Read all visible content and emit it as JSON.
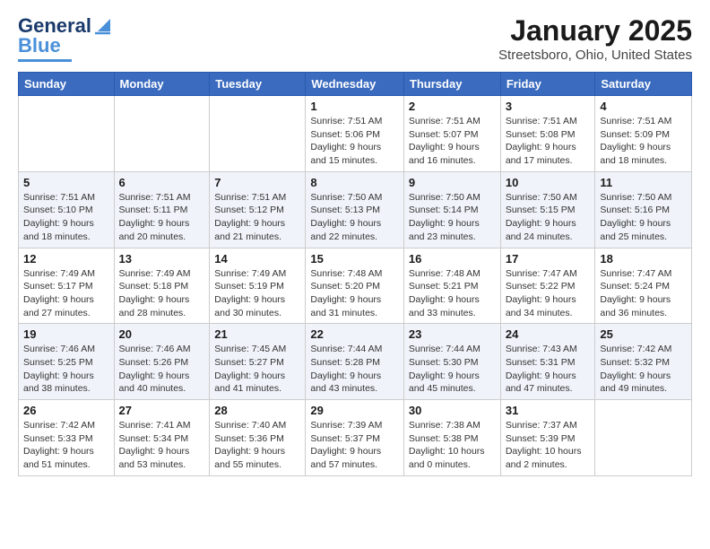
{
  "header": {
    "logo_text1": "General",
    "logo_text2": "Blue",
    "month": "January 2025",
    "location": "Streetsboro, Ohio, United States"
  },
  "weekdays": [
    "Sunday",
    "Monday",
    "Tuesday",
    "Wednesday",
    "Thursday",
    "Friday",
    "Saturday"
  ],
  "weeks": [
    [
      {
        "day": "",
        "info": ""
      },
      {
        "day": "",
        "info": ""
      },
      {
        "day": "",
        "info": ""
      },
      {
        "day": "1",
        "info": "Sunrise: 7:51 AM\nSunset: 5:06 PM\nDaylight: 9 hours\nand 15 minutes."
      },
      {
        "day": "2",
        "info": "Sunrise: 7:51 AM\nSunset: 5:07 PM\nDaylight: 9 hours\nand 16 minutes."
      },
      {
        "day": "3",
        "info": "Sunrise: 7:51 AM\nSunset: 5:08 PM\nDaylight: 9 hours\nand 17 minutes."
      },
      {
        "day": "4",
        "info": "Sunrise: 7:51 AM\nSunset: 5:09 PM\nDaylight: 9 hours\nand 18 minutes."
      }
    ],
    [
      {
        "day": "5",
        "info": "Sunrise: 7:51 AM\nSunset: 5:10 PM\nDaylight: 9 hours\nand 18 minutes."
      },
      {
        "day": "6",
        "info": "Sunrise: 7:51 AM\nSunset: 5:11 PM\nDaylight: 9 hours\nand 20 minutes."
      },
      {
        "day": "7",
        "info": "Sunrise: 7:51 AM\nSunset: 5:12 PM\nDaylight: 9 hours\nand 21 minutes."
      },
      {
        "day": "8",
        "info": "Sunrise: 7:50 AM\nSunset: 5:13 PM\nDaylight: 9 hours\nand 22 minutes."
      },
      {
        "day": "9",
        "info": "Sunrise: 7:50 AM\nSunset: 5:14 PM\nDaylight: 9 hours\nand 23 minutes."
      },
      {
        "day": "10",
        "info": "Sunrise: 7:50 AM\nSunset: 5:15 PM\nDaylight: 9 hours\nand 24 minutes."
      },
      {
        "day": "11",
        "info": "Sunrise: 7:50 AM\nSunset: 5:16 PM\nDaylight: 9 hours\nand 25 minutes."
      }
    ],
    [
      {
        "day": "12",
        "info": "Sunrise: 7:49 AM\nSunset: 5:17 PM\nDaylight: 9 hours\nand 27 minutes."
      },
      {
        "day": "13",
        "info": "Sunrise: 7:49 AM\nSunset: 5:18 PM\nDaylight: 9 hours\nand 28 minutes."
      },
      {
        "day": "14",
        "info": "Sunrise: 7:49 AM\nSunset: 5:19 PM\nDaylight: 9 hours\nand 30 minutes."
      },
      {
        "day": "15",
        "info": "Sunrise: 7:48 AM\nSunset: 5:20 PM\nDaylight: 9 hours\nand 31 minutes."
      },
      {
        "day": "16",
        "info": "Sunrise: 7:48 AM\nSunset: 5:21 PM\nDaylight: 9 hours\nand 33 minutes."
      },
      {
        "day": "17",
        "info": "Sunrise: 7:47 AM\nSunset: 5:22 PM\nDaylight: 9 hours\nand 34 minutes."
      },
      {
        "day": "18",
        "info": "Sunrise: 7:47 AM\nSunset: 5:24 PM\nDaylight: 9 hours\nand 36 minutes."
      }
    ],
    [
      {
        "day": "19",
        "info": "Sunrise: 7:46 AM\nSunset: 5:25 PM\nDaylight: 9 hours\nand 38 minutes."
      },
      {
        "day": "20",
        "info": "Sunrise: 7:46 AM\nSunset: 5:26 PM\nDaylight: 9 hours\nand 40 minutes."
      },
      {
        "day": "21",
        "info": "Sunrise: 7:45 AM\nSunset: 5:27 PM\nDaylight: 9 hours\nand 41 minutes."
      },
      {
        "day": "22",
        "info": "Sunrise: 7:44 AM\nSunset: 5:28 PM\nDaylight: 9 hours\nand 43 minutes."
      },
      {
        "day": "23",
        "info": "Sunrise: 7:44 AM\nSunset: 5:30 PM\nDaylight: 9 hours\nand 45 minutes."
      },
      {
        "day": "24",
        "info": "Sunrise: 7:43 AM\nSunset: 5:31 PM\nDaylight: 9 hours\nand 47 minutes."
      },
      {
        "day": "25",
        "info": "Sunrise: 7:42 AM\nSunset: 5:32 PM\nDaylight: 9 hours\nand 49 minutes."
      }
    ],
    [
      {
        "day": "26",
        "info": "Sunrise: 7:42 AM\nSunset: 5:33 PM\nDaylight: 9 hours\nand 51 minutes."
      },
      {
        "day": "27",
        "info": "Sunrise: 7:41 AM\nSunset: 5:34 PM\nDaylight: 9 hours\nand 53 minutes."
      },
      {
        "day": "28",
        "info": "Sunrise: 7:40 AM\nSunset: 5:36 PM\nDaylight: 9 hours\nand 55 minutes."
      },
      {
        "day": "29",
        "info": "Sunrise: 7:39 AM\nSunset: 5:37 PM\nDaylight: 9 hours\nand 57 minutes."
      },
      {
        "day": "30",
        "info": "Sunrise: 7:38 AM\nSunset: 5:38 PM\nDaylight: 10 hours\nand 0 minutes."
      },
      {
        "day": "31",
        "info": "Sunrise: 7:37 AM\nSunset: 5:39 PM\nDaylight: 10 hours\nand 2 minutes."
      },
      {
        "day": "",
        "info": ""
      }
    ]
  ]
}
